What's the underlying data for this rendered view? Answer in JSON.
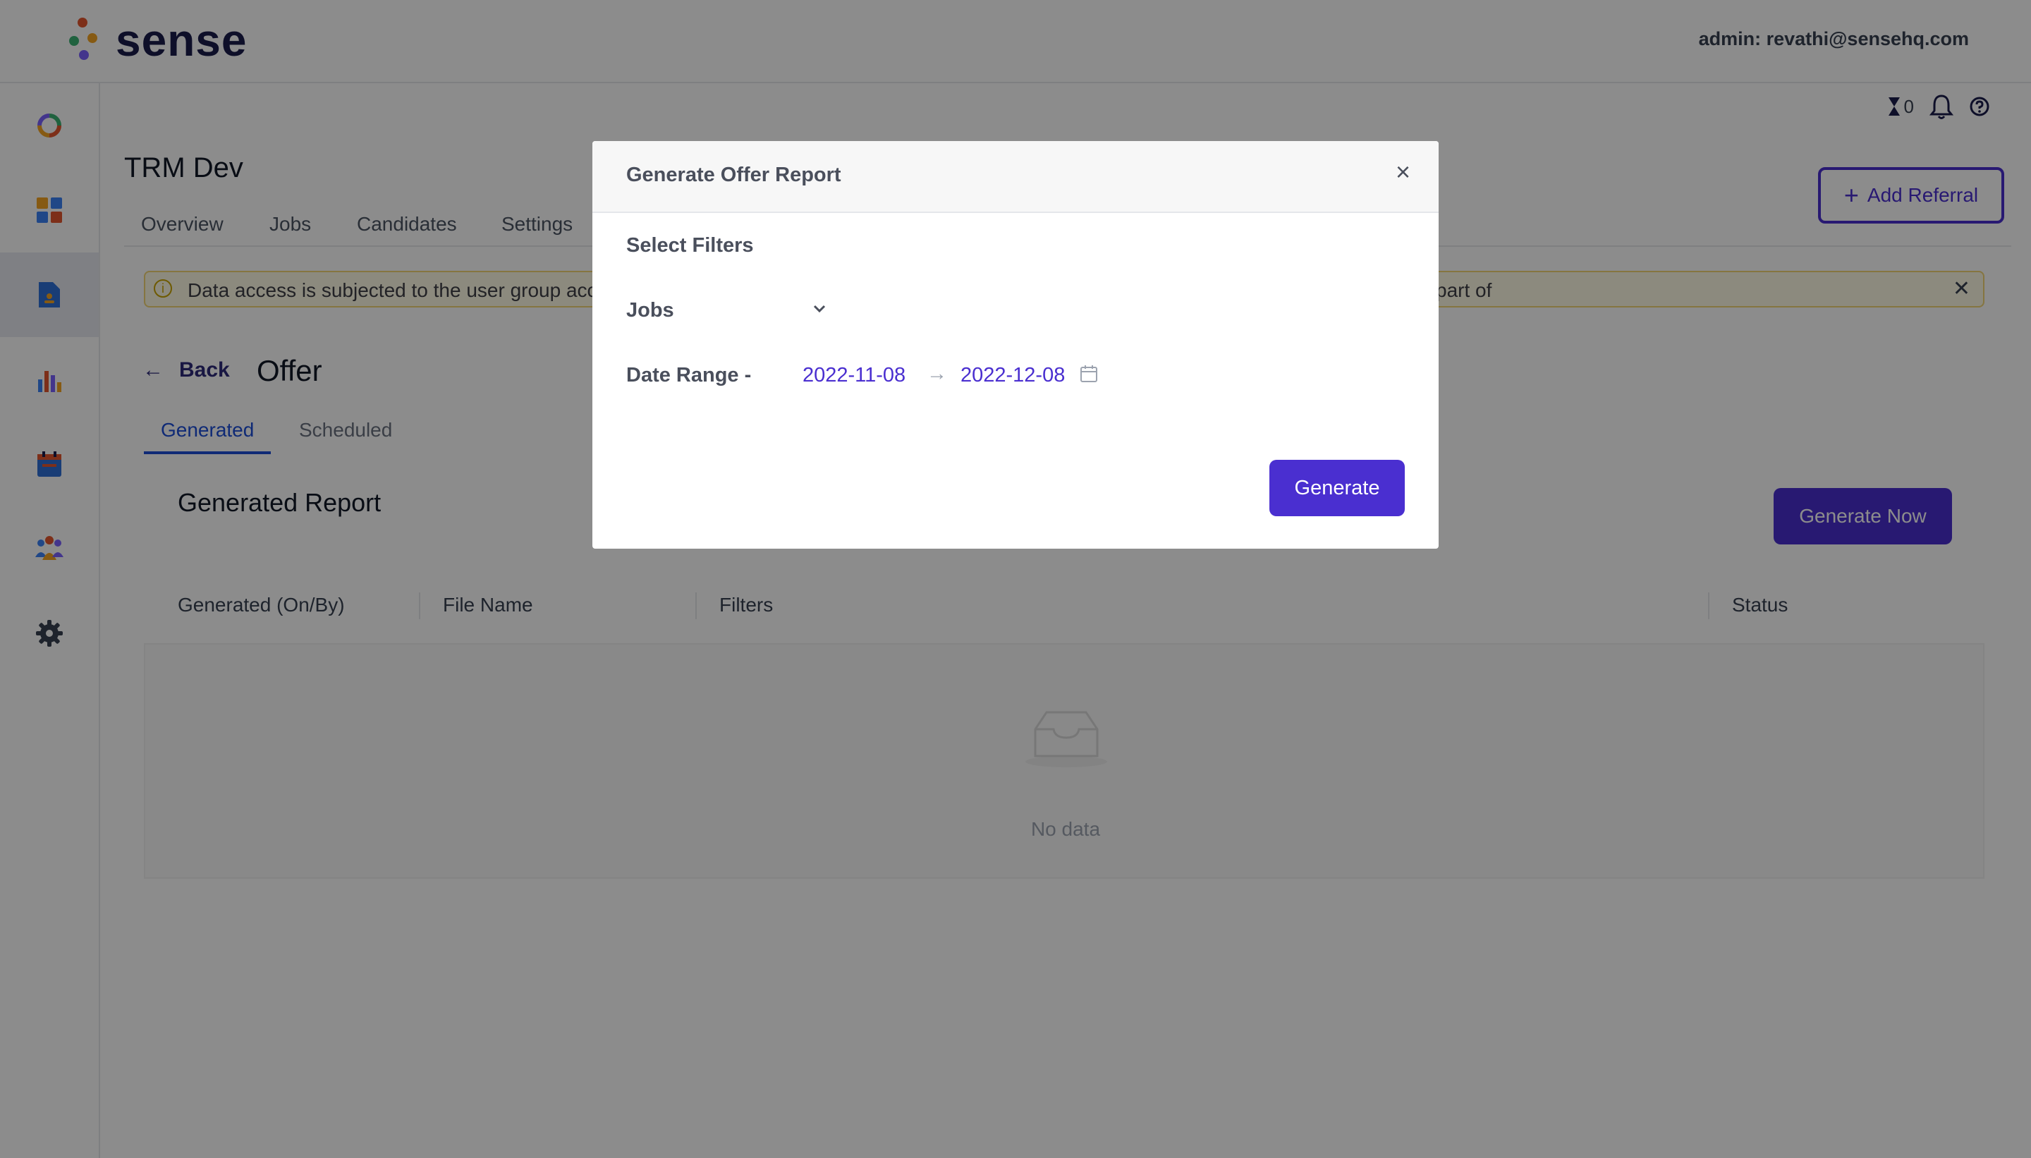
{
  "brand": {
    "name": "sense"
  },
  "header": {
    "admin_text": "admin: revathi@sensehq.com"
  },
  "sidebar": {
    "items": [
      {
        "icon": "ring-logo-icon"
      },
      {
        "icon": "dashboard-grid-icon"
      },
      {
        "icon": "report-document-icon",
        "active": true
      },
      {
        "icon": "bar-chart-icon"
      },
      {
        "icon": "calendar-icon"
      },
      {
        "icon": "people-group-icon"
      },
      {
        "icon": "gear-icon"
      }
    ]
  },
  "utility": {
    "hourglass_count": "0"
  },
  "page": {
    "title": "TRM Dev",
    "add_referral_label": "Add Referral",
    "nav_tabs": [
      "Overview",
      "Jobs",
      "Candidates",
      "Settings"
    ]
  },
  "alert": {
    "text_start": "Data access is subjected to the user group acc",
    "text_end": "part of"
  },
  "report": {
    "back_label": "Back",
    "title": "Offer",
    "tabs": [
      "Generated",
      "Scheduled"
    ],
    "section_title": "Generated Report",
    "generate_now_label": "Generate Now",
    "columns": [
      "Generated (On/By)",
      "File Name",
      "Filters",
      "Status"
    ],
    "empty_text": "No data"
  },
  "modal": {
    "title": "Generate Offer Report",
    "close_symbol": "×",
    "filters_heading": "Select Filters",
    "jobs_label": "Jobs",
    "date_range_label": "Date Range -",
    "date_start": "2022-11-08",
    "date_arrow": "→",
    "date_end": "2022-12-08",
    "generate_label": "Generate"
  },
  "colors": {
    "primary": "#4a2fd0",
    "tab_active": "#1d4ed8",
    "alert_bg": "#fffbe6",
    "overlay": "rgba(0,0,0,0.45)"
  }
}
